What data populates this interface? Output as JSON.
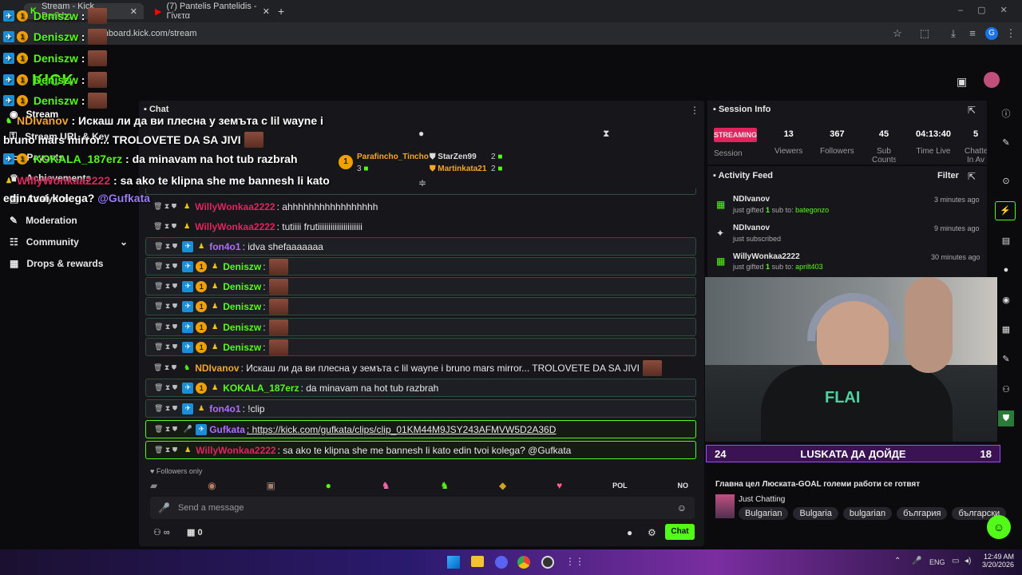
{
  "browser": {
    "tabs": [
      {
        "label": "Stream - Kick Dashbo"
      },
      {
        "label": "(7) Pantelis Pantelidis - Γίνετα"
      }
    ],
    "url": "dashboard.kick.com/stream"
  },
  "sidebar": {
    "items": [
      {
        "label": "Stream"
      },
      {
        "label": "Stream URL & Key"
      },
      {
        "label": "Payouts"
      },
      {
        "label": "Achievements"
      },
      {
        "label": "Analytics"
      },
      {
        "label": "Moderation"
      },
      {
        "label": "Community"
      },
      {
        "label": "Drops & rewards"
      }
    ]
  },
  "overlay": {
    "lines": [
      {
        "user": "Deniszw",
        "text": ":"
      },
      {
        "user": "Deniszw",
        "text": ":"
      },
      {
        "user": "Deniszw",
        "text": ":"
      },
      {
        "user": "Deniszw",
        "text": ":"
      },
      {
        "user": "Deniszw",
        "text": ":"
      }
    ],
    "ndi_user": "NDIvanov",
    "ndi_text": ": Искаш ли да ви плесна у земъта с lil wayne i",
    "ndi_text2": "bruno mars mirror... TROLOVETE DA SA JIVI",
    "kokala_user": "KOKALA_187erz",
    "kokala_text": ": da minavam na hot tub razbrah",
    "willy_user": "WillyWonkaa2222",
    "willy_text": ": sa ako te klipna she me bannesh li kato",
    "willy_text2": "edin tvoi kolega?",
    "willy_mention": "@Gufkata"
  },
  "chat": {
    "header": "Chat",
    "top_gifters": [
      {
        "name": "Parafincho_Tincho",
        "count": "3"
      },
      {
        "name": "StarZen99",
        "count": "2"
      },
      {
        "name": "Martinkata21",
        "count": "2"
      }
    ],
    "messages": [
      {
        "user": "WillyWonkaa2222",
        "color": "#e0245e",
        "text": ": ahhhhhhhhhhhhhhhhh"
      },
      {
        "user": "WillyWonkaa2222",
        "color": "#e0245e",
        "text": ": tutiiii frutiiiiiiiiiiiiiiiiiiiii"
      },
      {
        "user": "fon4o1",
        "color": "#b06cff",
        "text": ": idva shefaaaaaaa"
      },
      {
        "user": "Deniszw",
        "color": "#53fc18",
        "text": ":"
      },
      {
        "user": "Deniszw",
        "color": "#53fc18",
        "text": ":"
      },
      {
        "user": "Deniszw",
        "color": "#53fc18",
        "text": ":"
      },
      {
        "user": "Deniszw",
        "color": "#53fc18",
        "text": ":"
      },
      {
        "user": "Deniszw",
        "color": "#53fc18",
        "text": ":"
      },
      {
        "user": "NDIvanov",
        "color": "#f4a62a",
        "text": ": Искаш ли да ви плесна у земъта с lil wayne i bruno mars mirror... TROLOVETE DA SA JIVI"
      },
      {
        "user": "KOKALA_187erz",
        "color": "#53fc18",
        "text": ": da minavam na hot tub razbrah"
      },
      {
        "user": "fon4o1",
        "color": "#b06cff",
        "text": ": !clip"
      },
      {
        "user": "Gufkata",
        "color": "#b06cff",
        "text": ": https://kick.com/gufkata/clips/clip_01KM44M9JSY243AFMVW5D2A36D"
      },
      {
        "user": "WillyWonkaa2222",
        "color": "#e0245e",
        "text": ": sa ako te klipna she me bannesh li kato edin tvoi kolega? @Gufkata"
      }
    ],
    "followers_only": "Followers only",
    "quick_pol": "POL",
    "quick_no": "NO",
    "input_placeholder": "Send a message",
    "points": "0",
    "send_label": "Chat"
  },
  "session": {
    "title": "Session Info",
    "status": "STREAMING",
    "status_sub": "Session",
    "stats": [
      {
        "value": "13",
        "label": "Viewers"
      },
      {
        "value": "367",
        "label": "Followers"
      },
      {
        "value": "45",
        "label": "Sub Counts"
      },
      {
        "value": "04:13:40",
        "label": "Time Live"
      },
      {
        "value": "5",
        "label": "Chatters In Av"
      }
    ]
  },
  "activity": {
    "title": "Activity Feed",
    "filter": "Filter",
    "items": [
      {
        "name": "NDIvanov",
        "detail_pre": "just gifted",
        "count": "1",
        "detail_mid": "sub to:",
        "target": "bategonzo",
        "time": "3 minutes ago"
      },
      {
        "name": "NDIvanov",
        "detail_pre": "just subscribed",
        "count": "",
        "detail_mid": "",
        "target": "",
        "time": "9 minutes ago"
      },
      {
        "name": "WillyWonkaa2222",
        "detail_pre": "just gifted",
        "count": "1",
        "detail_mid": "sub to:",
        "target": "aprilt403",
        "time": "30 minutes ago"
      }
    ]
  },
  "goal": {
    "left": "24",
    "title": "LUSKATA ДА ДОЙДЕ",
    "right": "18"
  },
  "stream_info": {
    "title": "Главна цел Люската-GOAL големи работи се готвят",
    "category": "Just Chatting",
    "tags": [
      "Bulgarian",
      "Bulgaria",
      "bulgarian",
      "българия",
      "български"
    ]
  },
  "taskbar": {
    "lang": "ENG",
    "time": "12:49 AM",
    "date": "3/20/2026"
  },
  "colors": {
    "kick_green": "#53fc18",
    "goal_purple": "#3b1254",
    "streaming_red": "#e0245e"
  }
}
